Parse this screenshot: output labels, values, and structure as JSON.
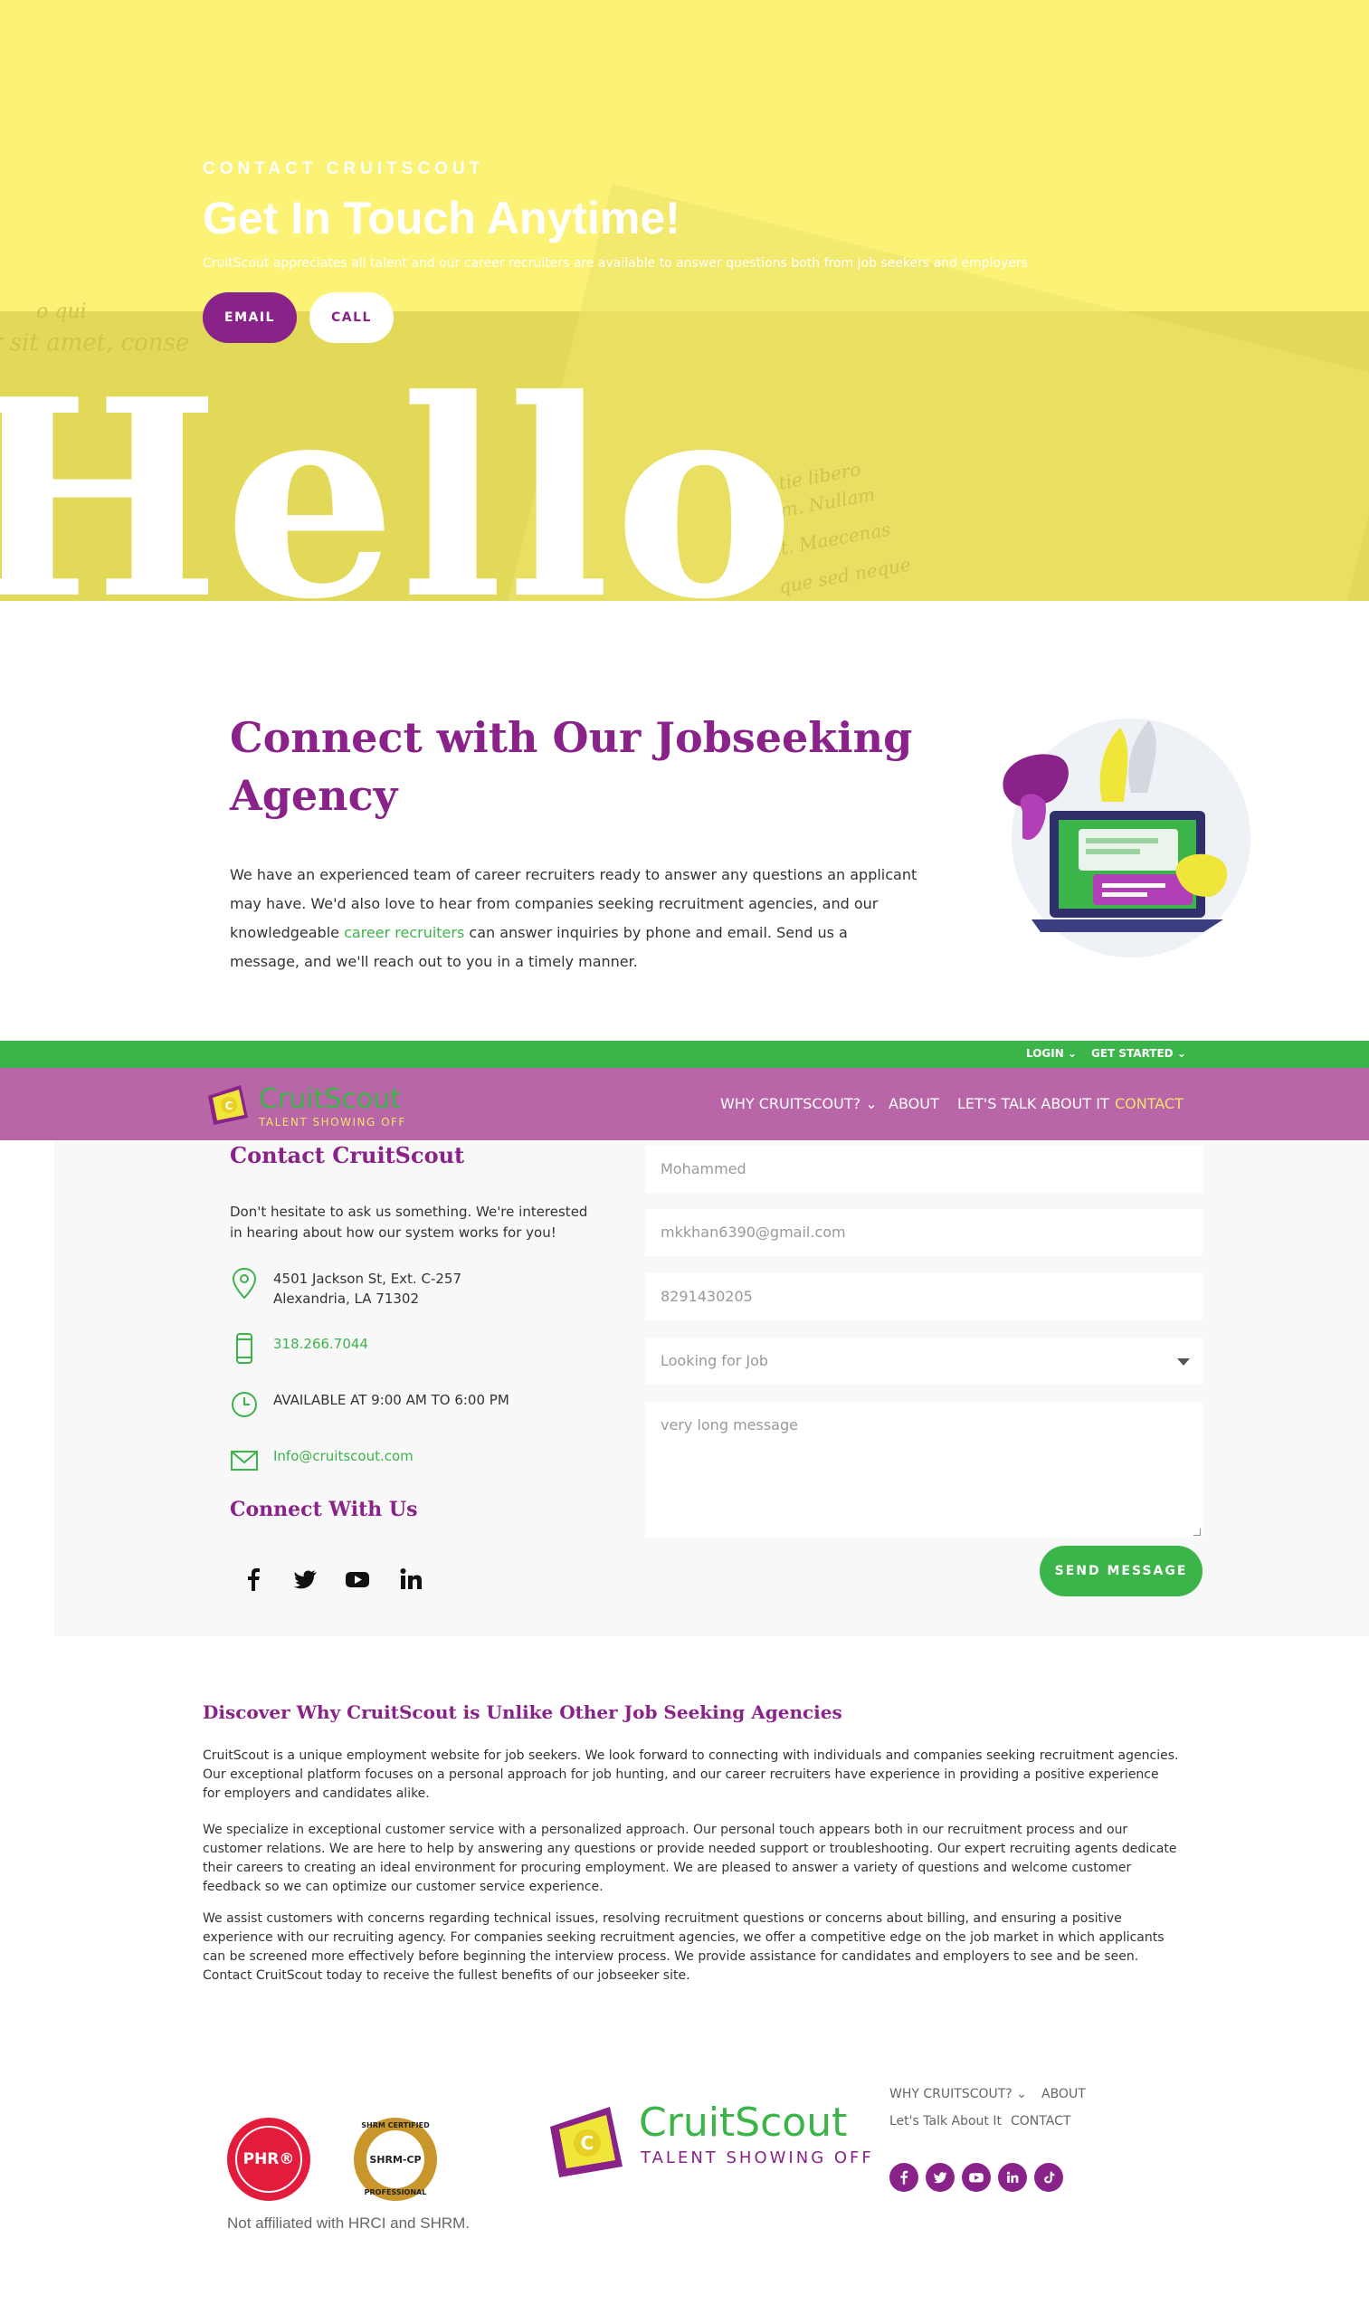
{
  "hero": {
    "eyebrow": "CONTACT CRUITSCOUT",
    "title": "Get In Touch Anytime!",
    "subtitle": "CruitScout appreciates all talent and our career recruiters are available to answer questions both from job seekers and employers",
    "email_button": "EMAIL",
    "call_button": "CALL",
    "big_word": "Hello",
    "paper_text": [
      "r sit amet, conse",
      "o qui",
      "tie libero",
      "am. Nullam",
      "at. Maecenas",
      "que sed neque"
    ]
  },
  "connect": {
    "title": "Connect with Our Jobseeking Agency",
    "text_before": "We have an experienced team of career recruiters ready to answer any questions an applicant may have. We'd also love to hear from companies seeking recruitment agencies, and our knowledgeable ",
    "link_text": "career recruiters",
    "text_after": " can answer inquiries by phone and email. Send us a message, and we'll reach out to you in a timely manner."
  },
  "topbar": {
    "login": "LOGIN",
    "get_started": "GET STARTED"
  },
  "nav": {
    "logo_name": "CruitScout",
    "logo_tagline": "TALENT SHOWING OFF",
    "items": [
      "WHY CRUITSCOUT?",
      "ABOUT",
      "LET'S TALK ABOUT IT",
      "CONTACT"
    ]
  },
  "contact": {
    "title": "Contact CruitScout",
    "description": "Don't hesitate to ask us something. We're interested in hearing about how our system works for you!",
    "address_line1": "4501 Jackson St, Ext. C-257",
    "address_line2": "Alexandria, LA 71302",
    "phone": "318.266.7044",
    "hours": "AVAILABLE AT 9:00 AM TO 6:00 PM",
    "email": "Info@cruitscout.com",
    "connect_title": "Connect With Us"
  },
  "form": {
    "name_value": "Mohammed",
    "email_value": "mkkhan6390@gmail.com",
    "phone_value": "8291430205",
    "reason_value": "Looking for Job",
    "message_value": "very long message",
    "send_button": "SEND MESSAGE"
  },
  "discover": {
    "title": "Discover Why CruitScout is Unlike Other Job Seeking Agencies",
    "paragraphs": [
      "CruitScout is a unique employment website for job seekers. We look forward to connecting with individuals and companies seeking recruitment agencies. Our exceptional platform focuses on a personal approach for job hunting, and our career recruiters have experience in providing a positive experience for employers and candidates alike.",
      "We specialize in exceptional customer service with a personalized approach. Our personal touch appears both in our recruitment process and our customer relations. We are here to help by answering any questions or provide needed support or troubleshooting. Our expert recruiting agents dedicate their careers to creating an ideal environment for procuring employment. We are pleased to answer a variety of questions and welcome customer feedback so we can optimize our customer service experience.",
      "We assist customers with concerns regarding technical issues, resolving recruitment questions or concerns about billing, and ensuring a positive experience with our recruiting agency. For companies seeking recruitment agencies, we offer a competitive edge on the job market in which applicants can be screened more effectively before beginning the interview process. We provide assistance for candidates and employers to see and be seen. Contact CruitScout today to receive the fullest benefits of our jobseeker site."
    ]
  },
  "footer": {
    "phr_badge": "PHR®",
    "shrm_top": "SHRM CERTIFIED",
    "shrm_center": "SHRM-CP",
    "shrm_bottom": "PROFESSIONAL",
    "affiliation": "Not affiliated with HRCI and SHRM.",
    "logo_name": "CruitScout",
    "logo_tagline": "TALENT SHOWING OFF",
    "links": [
      "WHY CRUITSCOUT?",
      "ABOUT",
      "Let's Talk About It",
      "CONTACT"
    ],
    "social_icons": [
      "facebook-icon",
      "twitter-icon",
      "youtube-icon",
      "linkedin-icon",
      "tiktok-icon"
    ]
  },
  "colors": {
    "brand_purple": "#8a2389",
    "brand_green": "#3bb44a",
    "hero_yellow": "#fbf276",
    "nav_purple": "#b966a8",
    "active_nav": "#f3e36a"
  }
}
